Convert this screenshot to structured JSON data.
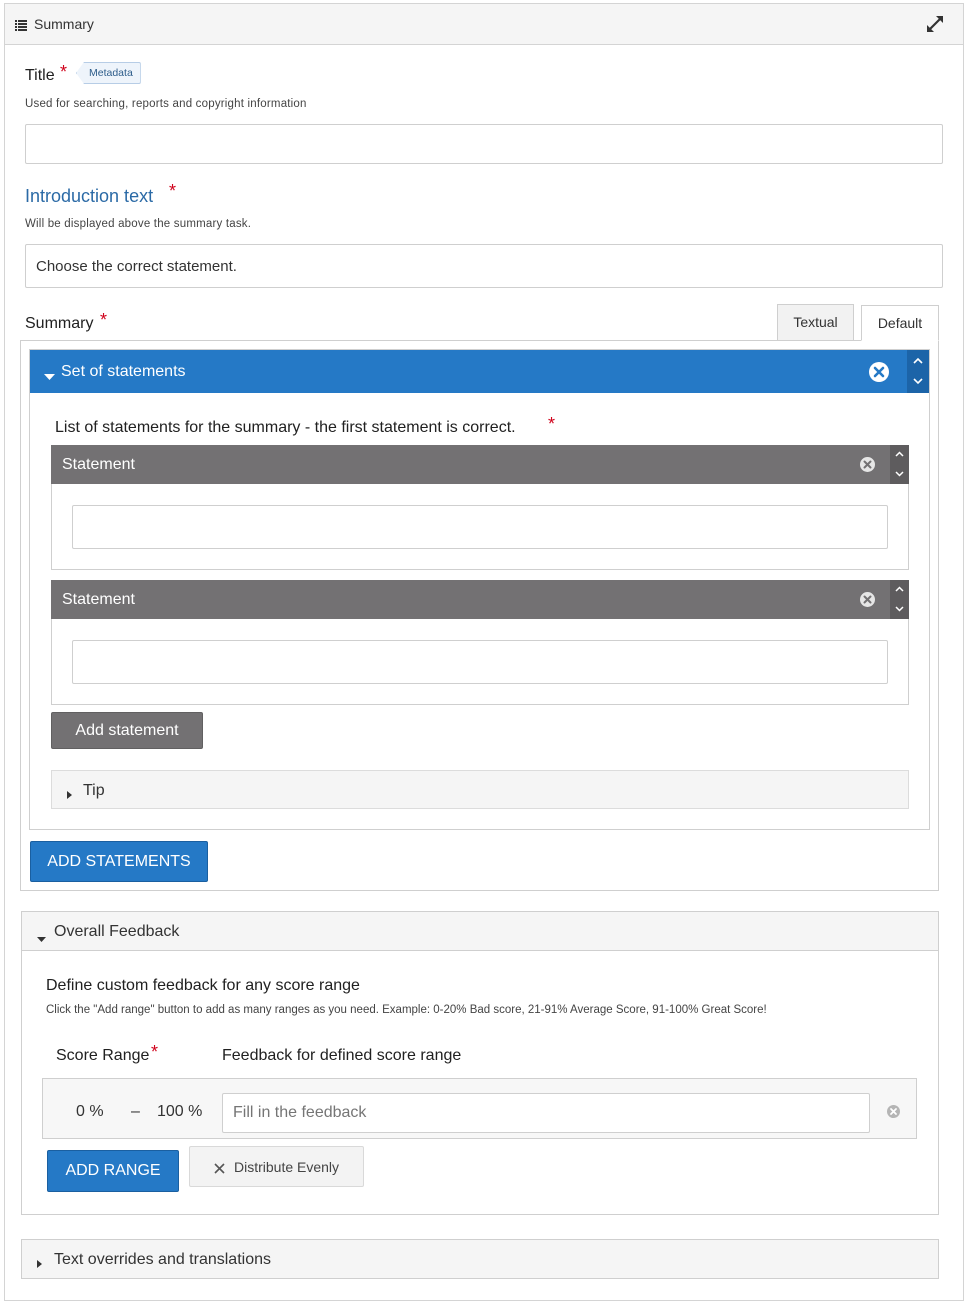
{
  "header": {
    "title": "Summary",
    "list_icon": "list-icon",
    "expand_icon": "expand-icon"
  },
  "title_field": {
    "label": "Title",
    "required_mark": "*",
    "badge": "Metadata",
    "description": "Used for searching, reports and copyright information",
    "value": ""
  },
  "intro_field": {
    "label": "Introduction text",
    "required_mark": "*",
    "description": "Will be displayed above the summary task.",
    "value": "Choose the correct statement."
  },
  "summary_field": {
    "label": "Summary",
    "required_mark": "*",
    "tabs": [
      {
        "label": "Textual",
        "active": false
      },
      {
        "label": "Default",
        "active": true
      }
    ],
    "group": {
      "title": "Set of statements",
      "list_label": "List of statements for the summary - the first statement is correct.",
      "required_mark": "*",
      "statements": [
        {
          "title": "Statement",
          "value": ""
        },
        {
          "title": "Statement",
          "value": ""
        }
      ],
      "add_statement_label": "Add statement",
      "tip_label": "Tip"
    },
    "add_statements_label": "ADD STATEMENTS"
  },
  "overall_feedback": {
    "title": "Overall Feedback",
    "heading": "Define custom feedback for any score range",
    "description": "Click the \"Add range\" button to add as many ranges as you need. Example: 0-20% Bad score, 21-91% Average Score, 91-100% Great Score!",
    "col_score_range": "Score Range",
    "required_mark": "*",
    "col_feedback": "Feedback for defined score range",
    "ranges": [
      {
        "from": "0 %",
        "separator": "–",
        "to": "100 %",
        "placeholder": "Fill in the feedback"
      }
    ],
    "add_range_label": "ADD RANGE",
    "distribute_label": "Distribute Evenly"
  },
  "overrides": {
    "title": "Text overrides and translations"
  },
  "colors": {
    "accent": "#2579c6",
    "accent_dark": "#1c64a8",
    "statement_header": "#737173",
    "required": "#d0021b",
    "intro_label": "#2b6aa6"
  }
}
